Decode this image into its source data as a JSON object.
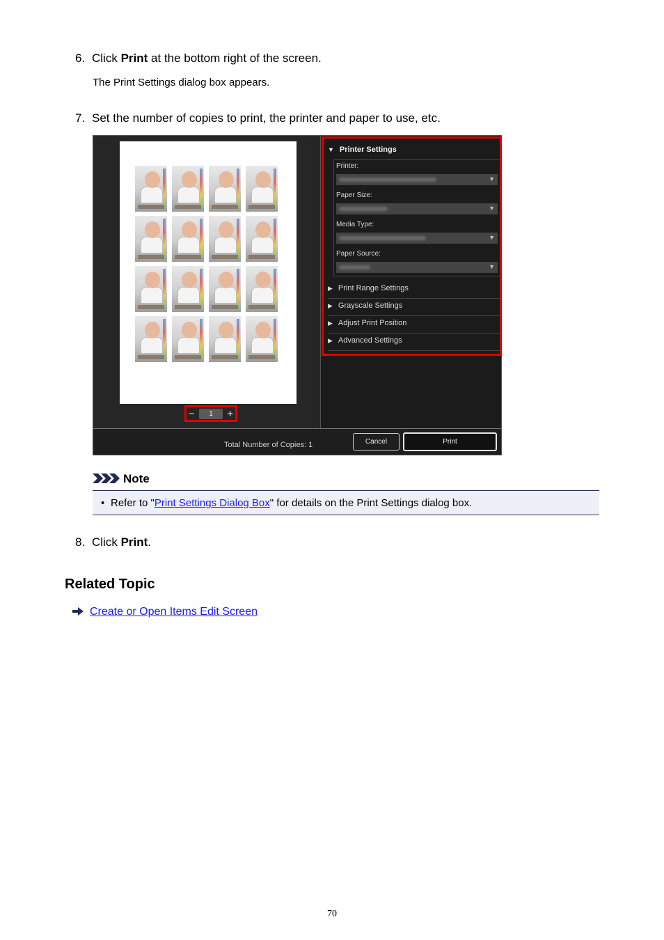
{
  "steps": [
    {
      "number": "6.",
      "prefix": "Click ",
      "bold": "Print",
      "suffix": " at the bottom right of the screen."
    },
    {
      "number": "7.",
      "text": "Set the number of copies to print, the printer and paper to use, etc."
    },
    {
      "number": "8.",
      "prefix": "Click ",
      "bold": "Print",
      "suffix": "."
    }
  ],
  "step6_subtext": "The Print Settings dialog box appears.",
  "screenshot": {
    "copies_value": "1",
    "minus_symbol": "−",
    "plus_symbol": "+",
    "printer_settings_header": "Printer Settings",
    "fields": {
      "printer_label": "Printer:",
      "paper_size_label": "Paper Size:",
      "media_type_label": "Media Type:",
      "paper_source_label": "Paper Source:"
    },
    "sections": {
      "print_range": "Print Range Settings",
      "grayscale": "Grayscale Settings",
      "adjust_position": "Adjust Print Position",
      "advanced": "Advanced Settings"
    },
    "total_copies_label": "Total Number of Copies:",
    "total_copies_value": "1",
    "cancel_button": "Cancel",
    "print_button": "Print"
  },
  "note": {
    "title": "Note",
    "bullet": "•",
    "text_before": "Refer to \"",
    "link_text": "Print Settings Dialog Box",
    "text_after": "\" for details on the Print Settings dialog box."
  },
  "related": {
    "heading": "Related Topic",
    "link_text": "Create or Open Items Edit Screen"
  },
  "page_number": "70",
  "colors": {
    "highlight": "#e00000",
    "link": "#1a1aff",
    "note_bg": "#eef0f8"
  }
}
